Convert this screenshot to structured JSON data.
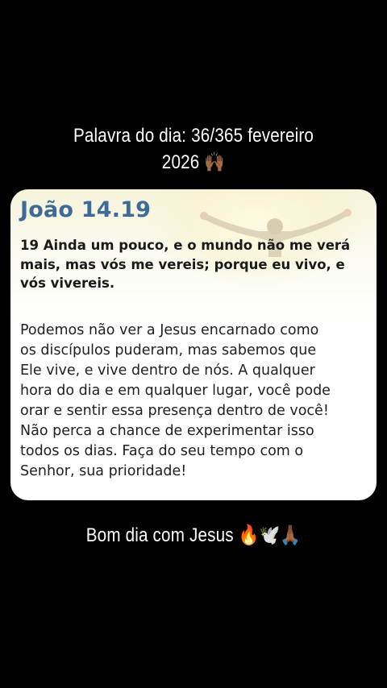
{
  "caption_top": {
    "line1": "Palavra do dia: 36/365 fevereiro",
    "line2": "2026 🙌🏾"
  },
  "card": {
    "title": "João 14.19",
    "verse_lines": [
      "19 Ainda um pouco, e o mundo não me verá",
      "mais, mas vós me vereis; porque eu vivo, e",
      "vós vivereis."
    ],
    "body_lines": [
      "Podemos não ver a Jesus encarnado como",
      "os discípulos puderam, mas sabemos que",
      "Ele vive, e vive dentro de nós. A qualquer",
      "hora do dia e em qualquer lugar, você pode",
      "orar e sentir essa presença dentro de você!",
      "Não perca a chance de experimentar isso",
      "todos os dias. Faça do seu tempo com o",
      "Senhor, sua prioridade!"
    ]
  },
  "caption_bottom": {
    "text": "Bom dia com Jesus 🔥🕊️🙏🏾"
  },
  "colors": {
    "background": "#000000",
    "caption_text": "#ffffff",
    "title_blue": "#3d6a97",
    "card_body": "#1f1f1f"
  }
}
